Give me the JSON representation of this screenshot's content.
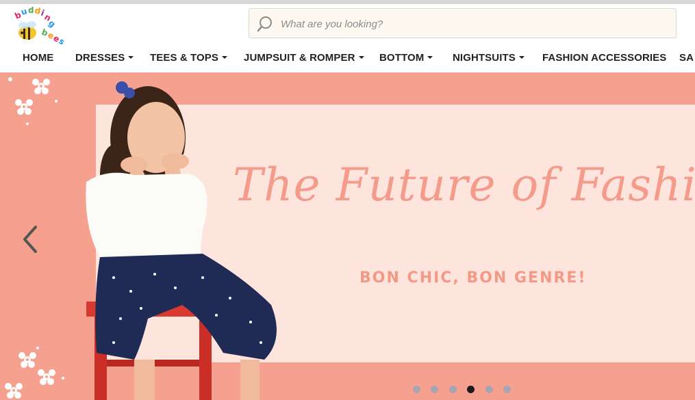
{
  "logo": {
    "text_top": "budding",
    "text_bottom": "bees"
  },
  "search": {
    "placeholder": "What are you looking?",
    "value": ""
  },
  "nav": [
    {
      "label": "HOME",
      "has_caret": false
    },
    {
      "label": "DRESSES",
      "has_caret": true
    },
    {
      "label": "TEES & TOPS",
      "has_caret": true
    },
    {
      "label": "JUMPSUIT & ROMPER",
      "has_caret": true
    },
    {
      "label": "BOTTOM",
      "has_caret": true
    },
    {
      "label": "NIGHTSUITS",
      "has_caret": true
    },
    {
      "label": "FASHION ACCESSORIES",
      "has_caret": false
    },
    {
      "label": "SA",
      "has_caret": false
    }
  ],
  "banner": {
    "headline": "The Future of Fashion",
    "tagline": "BON CHIC, BON GENRE!",
    "slides_total": 6,
    "active_slide": 4
  },
  "colors": {
    "banner_bg": "#f6a08f",
    "panel_bg": "#fde4dc",
    "headline": "#f49b8b",
    "dot_inactive": "#9aa4b8",
    "dot_active": "#1b1b1b"
  }
}
